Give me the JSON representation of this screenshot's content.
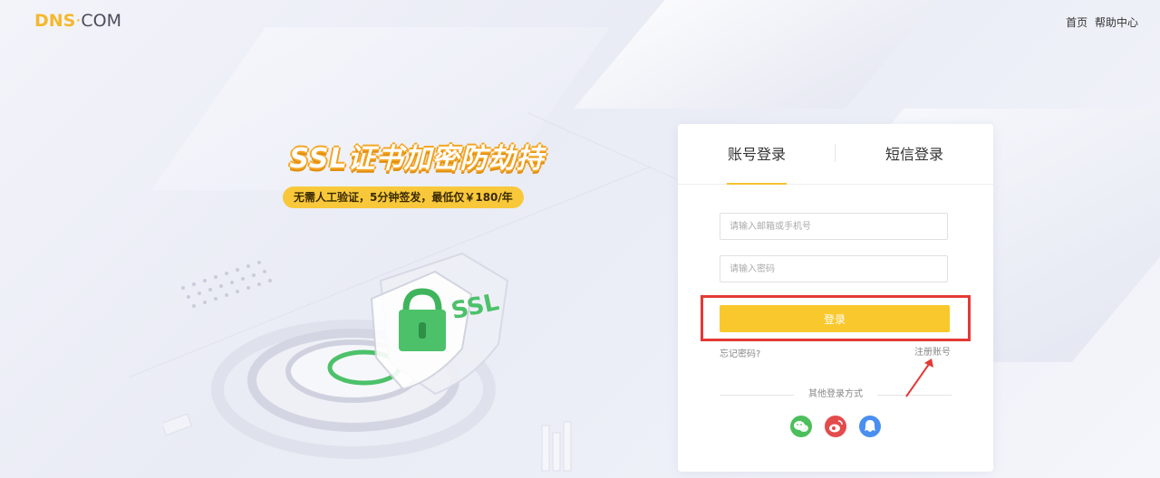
{
  "header": {
    "logo_dns": "DNS",
    "logo_com": "COM",
    "nav": [
      "首页",
      "帮助中心"
    ]
  },
  "promo": {
    "title": "SSL证书加密防劫持",
    "subtitle": "无需人工验证，5分钟签发，最低仅￥180/年",
    "badge_text": "SSL"
  },
  "login": {
    "tabs": [
      {
        "label": "账号登录",
        "active": true
      },
      {
        "label": "短信登录",
        "active": false
      }
    ],
    "username_placeholder": "请输入邮箱或手机号",
    "password_placeholder": "请输入密码",
    "submit_label": "登录",
    "forgot_label": "忘记密码?",
    "register_label": "注册账号",
    "other_methods_label": "其他登录方式",
    "social": [
      "wechat-icon",
      "weibo-icon",
      "qq-icon"
    ]
  },
  "colors": {
    "accent": "#f9c82c",
    "highlight": "#e53935",
    "wechat": "#4cbf5c",
    "weibo": "#e44b4b",
    "qq": "#4a8ff0"
  }
}
